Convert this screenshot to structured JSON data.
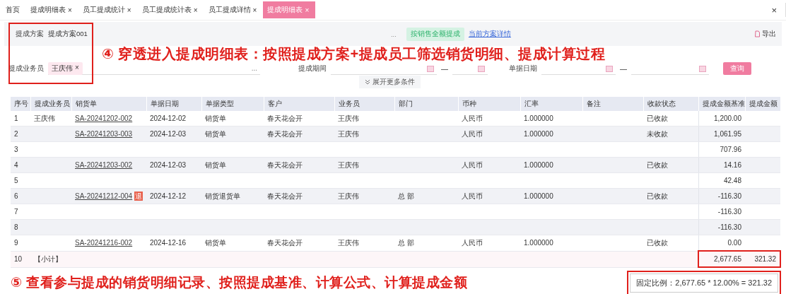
{
  "tabs": [
    {
      "label": "首页",
      "selected": false
    },
    {
      "label": "提成明细表",
      "close": "×",
      "selected": false
    },
    {
      "label": "员工提成统计",
      "close": "×",
      "selected": false
    },
    {
      "label": "员工提成统计表",
      "close": "×",
      "selected": false
    },
    {
      "label": "员工提成详情",
      "close": "×",
      "selected": false
    },
    {
      "label": "提成明细表",
      "close": "×",
      "selected": true
    }
  ],
  "window_close": "×",
  "filters": {
    "scheme_label": "提成方案",
    "scheme_value": "提成方案001",
    "more": "...",
    "rule_button": "按销售全额提成",
    "detail_link": "当前方案详情",
    "export": "导出",
    "salesman_label": "提成业务员",
    "salesman_tag": "王庆伟",
    "tag_close": "×",
    "salesman_more": "...",
    "period_label": "提成期间",
    "range_dash": "—",
    "date_label": "单据日期",
    "date_dash": "—",
    "query_button": "查询",
    "expand": "展开更多条件"
  },
  "annotation_top": "④ 穿透进入提成明细表：按照提成方案+提成员工筛选销货明细、提成计算过程",
  "table": {
    "columns": [
      "序号",
      "提成业务员",
      "销货单",
      "单据日期",
      "单据类型",
      "客户",
      "业务员",
      "部门",
      "币种",
      "汇率",
      "备注",
      "收款状态",
      "提成金额基准",
      "提成金额"
    ],
    "rows": [
      {
        "kind": "item",
        "cells": [
          "1",
          "王庆伟",
          "SA-20241202-002",
          "2024-12-02",
          "销货单",
          "春天花会开",
          "王庆伟",
          "",
          "人民币",
          "1.000000",
          "",
          "已收款",
          "1,200.00",
          ""
        ],
        "badge": ""
      },
      {
        "kind": "item",
        "cells": [
          "2",
          "",
          "SA-20241203-003",
          "2024-12-03",
          "销货单",
          "春天花会开",
          "王庆伟",
          "",
          "人民币",
          "1.000000",
          "",
          "未收款",
          "1,061.95",
          ""
        ],
        "badge": ""
      },
      {
        "kind": "item",
        "cells": [
          "3",
          "",
          "",
          "",
          "",
          "",
          "",
          "",
          "",
          "",
          "",
          "",
          "707.96",
          ""
        ],
        "badge": ""
      },
      {
        "kind": "item",
        "cells": [
          "4",
          "",
          "SA-20241203-002",
          "2024-12-03",
          "销货单",
          "春天花会开",
          "王庆伟",
          "",
          "人民币",
          "1.000000",
          "",
          "已收款",
          "14.16",
          ""
        ],
        "badge": ""
      },
      {
        "kind": "item",
        "cells": [
          "5",
          "",
          "",
          "",
          "",
          "",
          "",
          "",
          "",
          "",
          "",
          "",
          "42.48",
          ""
        ],
        "badge": ""
      },
      {
        "kind": "item",
        "cells": [
          "6",
          "",
          "SA-20241212-004",
          "2024-12-12",
          "销货退货单",
          "春天花会开",
          "王庆伟",
          "总 部",
          "人民币",
          "1.000000",
          "",
          "已收款",
          "-116.30",
          ""
        ],
        "badge": "退"
      },
      {
        "kind": "item",
        "cells": [
          "7",
          "",
          "",
          "",
          "",
          "",
          "",
          "",
          "",
          "",
          "",
          "",
          "-116.30",
          ""
        ],
        "badge": ""
      },
      {
        "kind": "item",
        "cells": [
          "8",
          "",
          "",
          "",
          "",
          "",
          "",
          "",
          "",
          "",
          "",
          "",
          "-116.30",
          ""
        ],
        "badge": ""
      },
      {
        "kind": "item",
        "cells": [
          "9",
          "",
          "SA-20241216-002",
          "2024-12-16",
          "销货单",
          "春天花会开",
          "王庆伟",
          "总 部",
          "人民币",
          "1.000000",
          "",
          "已收款",
          "0.00",
          ""
        ],
        "badge": ""
      },
      {
        "kind": "subtotal",
        "cells": [
          "10",
          "【小计】",
          "",
          "",
          "",
          "",
          "",
          "",
          "",
          "",
          "",
          "",
          "2,677.65",
          "321.32"
        ],
        "badge": ""
      }
    ]
  },
  "annotation_bottom": "⑤ 查看参与提成的销货明细记录、按照提成基准、计算公式、计算提成金额",
  "formula_tooltip": "固定比例：2,677.65 * 12.00% = 321.32"
}
